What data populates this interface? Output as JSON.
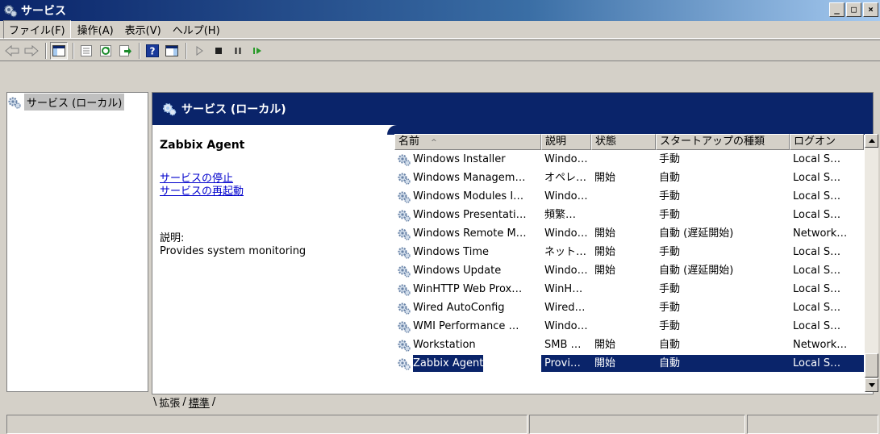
{
  "window": {
    "title": "サービス",
    "controls": [
      "_",
      "□",
      "×"
    ]
  },
  "menu": [
    {
      "label": "ファイル(F)"
    },
    {
      "label": "操作(A)"
    },
    {
      "label": "表示(V)"
    },
    {
      "label": "ヘルプ(H)"
    }
  ],
  "toolbar": {
    "icons": [
      "back-icon",
      "forward-icon",
      "show-hide-tree-icon",
      "properties-icon",
      "refresh-icon",
      "export-list-icon",
      "help-icon",
      "show-action-pane-icon",
      "start-service-icon",
      "stop-service-icon",
      "pause-service-icon",
      "restart-service-icon"
    ]
  },
  "tree": {
    "root_label": "サービス (ローカル)"
  },
  "pane": {
    "header_title": "サービス (ローカル)"
  },
  "details": {
    "service_name": "Zabbix Agent",
    "stop_link": "サービスの停止",
    "restart_link": "サービスの再起動",
    "description_label": "説明:",
    "description_text": "Provides system monitoring"
  },
  "list": {
    "columns": [
      "名前",
      "説明",
      "状態",
      "スタートアップの種類",
      "ログオン"
    ],
    "sort_indicator": "^",
    "rows": [
      {
        "name": "Windows Installer",
        "desc": "Windo…",
        "status": "",
        "startup": "手動",
        "logon": "Local S…"
      },
      {
        "name": "Windows Managem…",
        "desc": "オペレ…",
        "status": "開始",
        "startup": "自動",
        "logon": "Local S…"
      },
      {
        "name": "Windows Modules I…",
        "desc": "Windo…",
        "status": "",
        "startup": "手動",
        "logon": "Local S…"
      },
      {
        "name": "Windows Presentati…",
        "desc": "頻繁…",
        "status": "",
        "startup": "手動",
        "logon": "Local S…"
      },
      {
        "name": "Windows Remote M…",
        "desc": "Windo…",
        "status": "開始",
        "startup": "自動 (遅延開始)",
        "logon": "Network…"
      },
      {
        "name": "Windows Time",
        "desc": "ネット…",
        "status": "開始",
        "startup": "手動",
        "logon": "Local S…"
      },
      {
        "name": "Windows Update",
        "desc": "Windo…",
        "status": "開始",
        "startup": "自動 (遅延開始)",
        "logon": "Local S…"
      },
      {
        "name": "WinHTTP Web Prox…",
        "desc": "WinH…",
        "status": "",
        "startup": "手動",
        "logon": "Local S…"
      },
      {
        "name": "Wired AutoConfig",
        "desc": "Wired…",
        "status": "",
        "startup": "手動",
        "logon": "Local S…"
      },
      {
        "name": "WMI Performance …",
        "desc": "Windo…",
        "status": "",
        "startup": "手動",
        "logon": "Local S…"
      },
      {
        "name": "Workstation",
        "desc": "SMB …",
        "status": "開始",
        "startup": "自動",
        "logon": "Network…"
      },
      {
        "name": "Zabbix Agent",
        "desc": "Provi…",
        "status": "開始",
        "startup": "自動",
        "logon": "Local S…",
        "selected": true
      }
    ]
  },
  "tabs": [
    {
      "label": "拡張"
    },
    {
      "label": "標準"
    }
  ],
  "colors": {
    "selection": "#0a246a",
    "link": "#0000cc",
    "header": "#0a246a"
  }
}
